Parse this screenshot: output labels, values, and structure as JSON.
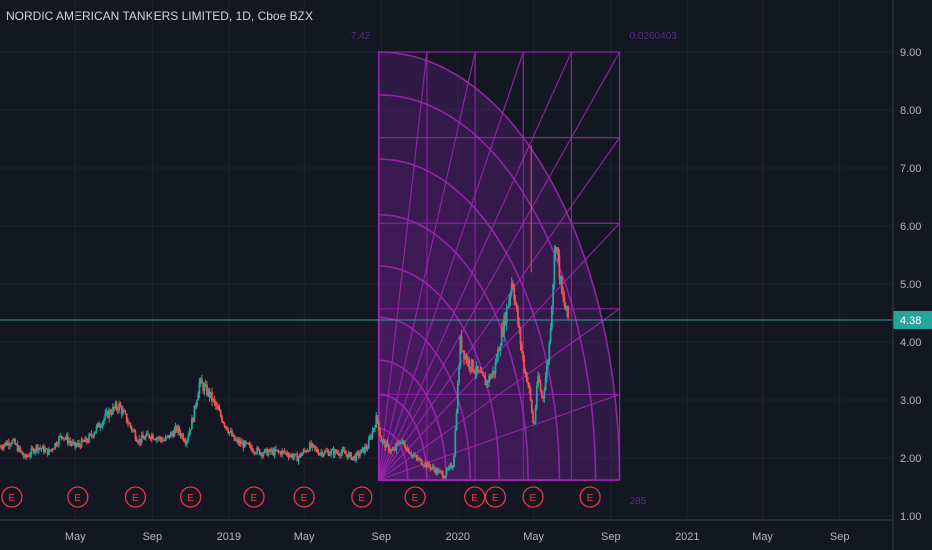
{
  "header": {
    "title": "NORDIC AMERICAN TANKERS LIMITED, 1D, Cboe BZX"
  },
  "colors": {
    "background": "#131722",
    "up": "#26a69a",
    "down": "#ef5350",
    "fib": "#9c27b0",
    "fib_fill": "#7b1fa2",
    "price_line": "#26a69a",
    "earnings": "#f23645",
    "grid": "#1e222d",
    "text": "#b2b5be"
  },
  "chart_data": {
    "type": "line",
    "title": "NORDIC AMERICAN TANKERS LIMITED, 1D, Cboe BZX",
    "ylim": [
      1.0,
      9.2
    ],
    "yticks": [
      "9.00",
      "8.00",
      "7.00",
      "6.00",
      "5.00",
      "4.00",
      "3.00",
      "2.00",
      "1.00"
    ],
    "ytick_values": [
      9,
      8,
      7,
      6,
      5,
      4,
      3,
      2,
      1
    ],
    "xticks": [
      "May",
      "Sep",
      "2019",
      "May",
      "Sep",
      "2020",
      "May",
      "Sep",
      "2021",
      "May",
      "Sep"
    ],
    "xtick_dates": [
      "2018-05-01",
      "2018-09-01",
      "2019-01-01",
      "2019-05-01",
      "2019-09-01",
      "2020-01-01",
      "2020-05-01",
      "2020-09-01",
      "2021-01-01",
      "2021-05-01",
      "2021-09-01"
    ],
    "xlim_dates": [
      "2018-01-01",
      "2021-11-25"
    ],
    "last_price": "4.38",
    "last_price_value": 4.38,
    "series": [
      {
        "dates": [
          "2018-01-01",
          "2018-01-20",
          "2018-02-10",
          "2018-03-01",
          "2018-03-20",
          "2018-04-10",
          "2018-04-30",
          "2018-05-20",
          "2018-06-10",
          "2018-06-25",
          "2018-07-10",
          "2018-07-25",
          "2018-08-10",
          "2018-08-30",
          "2018-09-20",
          "2018-10-10",
          "2018-10-25",
          "2018-11-05",
          "2018-11-15",
          "2018-12-01",
          "2018-12-20",
          "2019-01-10",
          "2019-01-31",
          "2019-02-20",
          "2019-03-10",
          "2019-03-30",
          "2019-04-20",
          "2019-05-10",
          "2019-05-25",
          "2019-06-10",
          "2019-06-30",
          "2019-07-20",
          "2019-08-10",
          "2019-08-25",
          "2019-09-01",
          "2019-09-10",
          "2019-09-20",
          "2019-10-01",
          "2019-10-10",
          "2019-10-25",
          "2019-11-10",
          "2019-11-25",
          "2019-12-10",
          "2019-12-25",
          "2020-01-05",
          "2020-01-15",
          "2020-01-30",
          "2020-02-15",
          "2020-02-28",
          "2020-03-10",
          "2020-03-20",
          "2020-03-28",
          "2020-04-05",
          "2020-04-15",
          "2020-04-22",
          "2020-04-27",
          "2020-05-01",
          "2020-05-08",
          "2020-05-15",
          "2020-05-25",
          "2020-06-05",
          "2020-06-15",
          "2020-06-25"
        ],
        "values": [
          2.2,
          2.3,
          2.0,
          2.2,
          2.1,
          2.4,
          2.2,
          2.3,
          2.6,
          2.8,
          2.9,
          2.6,
          2.3,
          2.4,
          2.3,
          2.5,
          2.3,
          2.7,
          3.3,
          3.1,
          2.7,
          2.3,
          2.2,
          2.1,
          2.1,
          2.1,
          2.0,
          2.2,
          2.1,
          2.1,
          2.1,
          2.0,
          2.2,
          2.7,
          2.3,
          2.2,
          2.1,
          2.3,
          2.2,
          2.0,
          1.9,
          1.8,
          1.7,
          1.9,
          4.0,
          3.7,
          3.5,
          3.3,
          3.5,
          4.1,
          4.6,
          5.1,
          4.4,
          3.6,
          3.3,
          2.9,
          2.5,
          3.4,
          3.0,
          3.8,
          5.8,
          4.8,
          4.4
        ]
      }
    ],
    "fib_fan": {
      "start_date": "2019-08-28",
      "end_date": "2020-09-15",
      "low": 1.62,
      "high": 9.0,
      "label_top_left": "7.42",
      "label_top_right": "0.0260403",
      "label_bottom_right": "285"
    },
    "earnings": [
      "2018-01-20",
      "2018-05-05",
      "2018-08-05",
      "2018-11-01",
      "2019-02-10",
      "2019-05-01",
      "2019-08-01",
      "2019-10-25",
      "2020-01-28",
      "2020-03-01",
      "2020-04-30",
      "2020-07-30"
    ],
    "earnings_label": "E"
  }
}
